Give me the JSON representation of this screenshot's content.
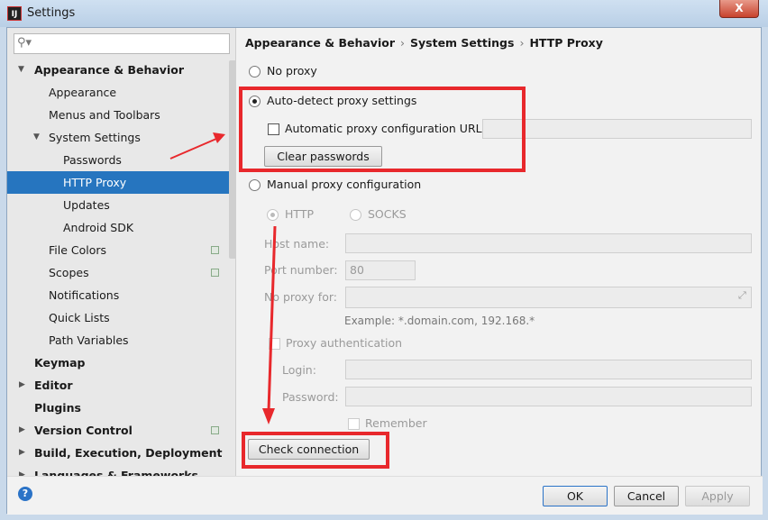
{
  "window": {
    "title": "Settings",
    "close_label": "X"
  },
  "search": {
    "placeholder": ""
  },
  "sidebar": {
    "items": [
      {
        "label": "Appearance & Behavior"
      },
      {
        "label": "Appearance"
      },
      {
        "label": "Menus and Toolbars"
      },
      {
        "label": "System Settings"
      },
      {
        "label": "Passwords"
      },
      {
        "label": "HTTP Proxy"
      },
      {
        "label": "Updates"
      },
      {
        "label": "Android SDK"
      },
      {
        "label": "File Colors"
      },
      {
        "label": "Scopes"
      },
      {
        "label": "Notifications"
      },
      {
        "label": "Quick Lists"
      },
      {
        "label": "Path Variables"
      },
      {
        "label": "Keymap"
      },
      {
        "label": "Editor"
      },
      {
        "label": "Plugins"
      },
      {
        "label": "Version Control"
      },
      {
        "label": "Build, Execution, Deployment"
      },
      {
        "label": "Languages & Frameworks"
      }
    ]
  },
  "breadcrumb": {
    "items": [
      "Appearance & Behavior",
      "System Settings",
      "HTTP Proxy"
    ],
    "separator": "›"
  },
  "proxy": {
    "no_proxy": "No proxy",
    "auto_detect": "Auto-detect proxy settings",
    "auto_url_label": "Automatic proxy configuration URL:",
    "auto_url_value": "",
    "clear_passwords": "Clear passwords",
    "manual": "Manual proxy configuration",
    "http": "HTTP",
    "socks": "SOCKS",
    "host_label": "Host name:",
    "host_value": "",
    "port_label": "Port number:",
    "port_value": "80",
    "no_proxy_for_label": "No proxy for:",
    "no_proxy_for_value": "",
    "example": "Example: *.domain.com, 192.168.*",
    "proxy_auth": "Proxy authentication",
    "login_label": "Login:",
    "login_value": "",
    "password_label": "Password:",
    "password_value": "",
    "remember": "Remember",
    "check_connection": "Check connection",
    "selected": "Auto-detect proxy settings"
  },
  "footer": {
    "ok": "OK",
    "cancel": "Cancel",
    "apply": "Apply",
    "help": "?"
  },
  "annotation_color": "#e8282c",
  "selection_color": "#2675bf"
}
